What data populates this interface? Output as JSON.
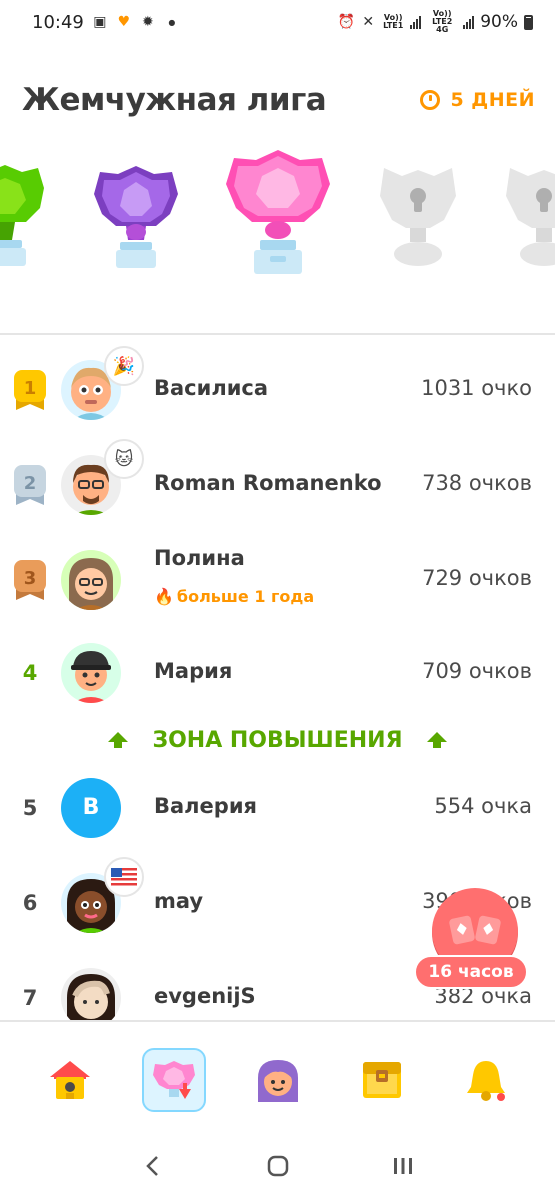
{
  "status_bar": {
    "time": "10:49",
    "signal_labels": [
      "Vo)) LTE1",
      "Vo)) LTE2 4G"
    ],
    "battery": "90%"
  },
  "header": {
    "league_title": "Жемчужная лига",
    "time_left": "5 ДНЕЙ"
  },
  "leagues": [
    {
      "icon": "emerald-league-icon",
      "color": "#58cc02"
    },
    {
      "icon": "amethyst-league-icon",
      "color": "#9b59d6"
    },
    {
      "icon": "pearl-league-icon",
      "color": "#ff86d0",
      "current": true
    },
    {
      "icon": "locked-league-icon",
      "color": "#e5e5e5"
    },
    {
      "icon": "locked-league-icon",
      "color": "#e5e5e5"
    }
  ],
  "leaderboard": {
    "rows": [
      {
        "rank": "1",
        "name": "Василиса",
        "points": "1031 очко"
      },
      {
        "rank": "2",
        "name": "Roman Romanenko",
        "points": "738 очков"
      },
      {
        "rank": "3",
        "name": "Полина",
        "subtitle": "больше 1 года",
        "points": "729 очков"
      },
      {
        "rank": "4",
        "name": "Мария",
        "points": "709 очков"
      },
      {
        "rank": "5",
        "name": "Валерия",
        "avatar_letter": "В",
        "points": "554 очка"
      },
      {
        "rank": "6",
        "name": "may",
        "points": "390 очков"
      },
      {
        "rank": "7",
        "name": "evgenijS",
        "points": "382 очка"
      }
    ],
    "promotion_zone_label": "ЗОНА ПОВЫШЕНИЯ"
  },
  "chest": {
    "timer": "16 часов"
  },
  "bottom_nav": [
    "home-icon",
    "leagues-icon",
    "profile-icon",
    "shop-chest-icon",
    "notifications-bell-icon"
  ]
}
